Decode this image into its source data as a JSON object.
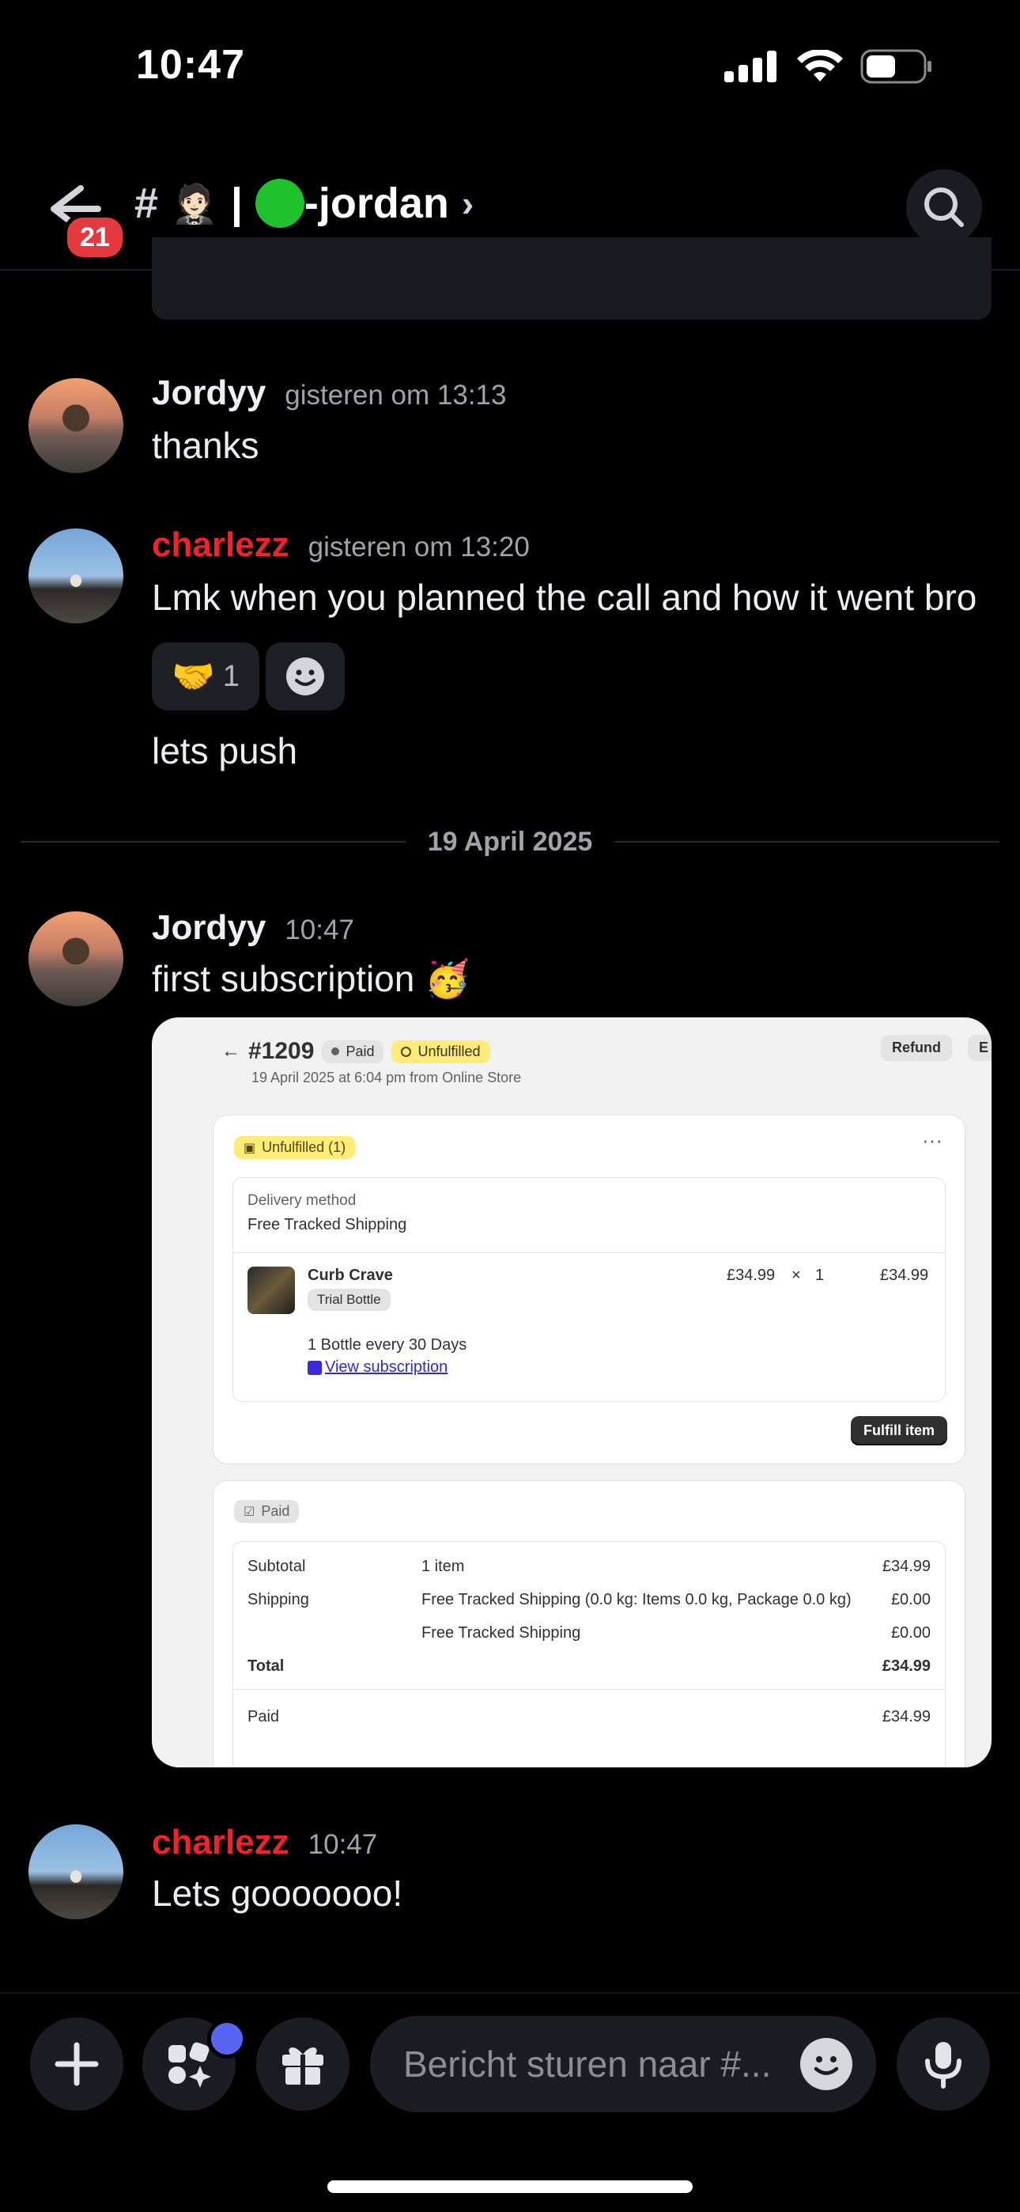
{
  "status_bar": {
    "time": "10:47"
  },
  "header": {
    "back_badge": "21",
    "channel_prefix": "#",
    "channel_emoji": "🤵🏻",
    "separator": "|",
    "channel_name": "-jordan",
    "chevron": "›"
  },
  "messages": [
    {
      "author": "Jordyy",
      "timestamp": "gisteren om 13:13",
      "text": "thanks"
    },
    {
      "author": "charlezz",
      "timestamp": "gisteren om 13:20",
      "text": "Lmk when you planned the call and how it went bro",
      "reaction_emoji": "🤝",
      "reaction_count": "1",
      "text2": "lets push"
    },
    {
      "author": "Jordyy",
      "timestamp": "10:47",
      "text": "first subscription 🥳"
    },
    {
      "author": "charlezz",
      "timestamp": "10:47",
      "text": "Lets gooooooo!"
    }
  ],
  "date_divider": "19 April 2025",
  "order": {
    "number": "#1209",
    "paid_badge": "Paid",
    "unfulfilled_badge": "Unfulfilled",
    "refund": "Refund",
    "edit_partial": "E",
    "date_line": "19 April 2025 at 6:04 pm from Online Store",
    "unfulfilled_count": "Unfulfilled (1)",
    "delivery_label": "Delivery method",
    "delivery_value": "Free Tracked Shipping",
    "product_name": "Curb Crave",
    "product_variant": "Trial Bottle",
    "price": "£34.99",
    "times": "×",
    "qty": "1",
    "line_total": "£34.99",
    "subscription_plan": "1 Bottle every 30 Days",
    "view_subscription": "View subscription",
    "fulfill_button": "Fulfill item",
    "paid_section": "Paid",
    "summary": [
      {
        "label": "Subtotal",
        "desc": "1 item",
        "amount": "£34.99"
      },
      {
        "label": "Shipping",
        "desc": "Free Tracked Shipping (0.0 kg: Items 0.0 kg, Package 0.0 kg)",
        "amount": "£0.00"
      },
      {
        "label": "",
        "desc": "Free Tracked Shipping",
        "amount": "£0.00"
      },
      {
        "label": "Total",
        "desc": "",
        "amount": "£34.99"
      }
    ],
    "paid_label": "Paid",
    "paid_amount": "£34.99"
  },
  "composer": {
    "placeholder": "Bericht sturen naar #..."
  },
  "colors": {
    "accent": "#5865f2",
    "mention_red": "#f0232a",
    "badge_red": "#e5393f"
  }
}
